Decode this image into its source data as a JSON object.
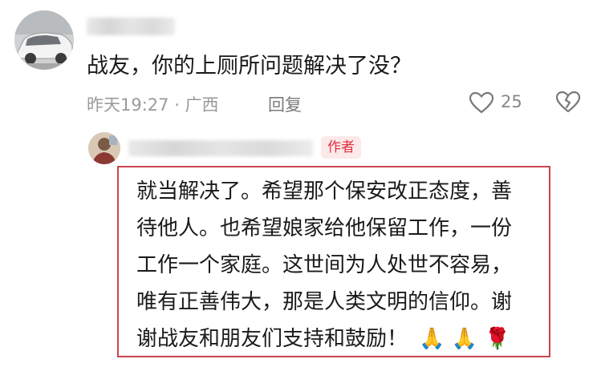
{
  "comment": {
    "text": "战友，你的上厕所问题解决了没？",
    "time_location": "昨天19:27 · 广西",
    "reply_label": "回复",
    "like_count": "25",
    "icons": {
      "like": "heart-outline-icon",
      "dislike": "broken-heart-icon"
    }
  },
  "author_reply": {
    "badge": "作者",
    "lines": [
      "就当解决了。希望那个保安改正态度，善",
      "待他人。也希望娘家给他保留工作，一份",
      "工作一个家庭。这世间为人处世不容易，",
      "唯有正善伟大，那是人类文明的信仰。谢",
      "谢战友和朋友们支持和鼓励！"
    ],
    "emojis": [
      "🙏",
      "🙏",
      "🌹"
    ],
    "colors": {
      "highlight_border": "#c9464f",
      "badge_text": "#e2313e",
      "badge_bg": "#fce9ea"
    }
  }
}
